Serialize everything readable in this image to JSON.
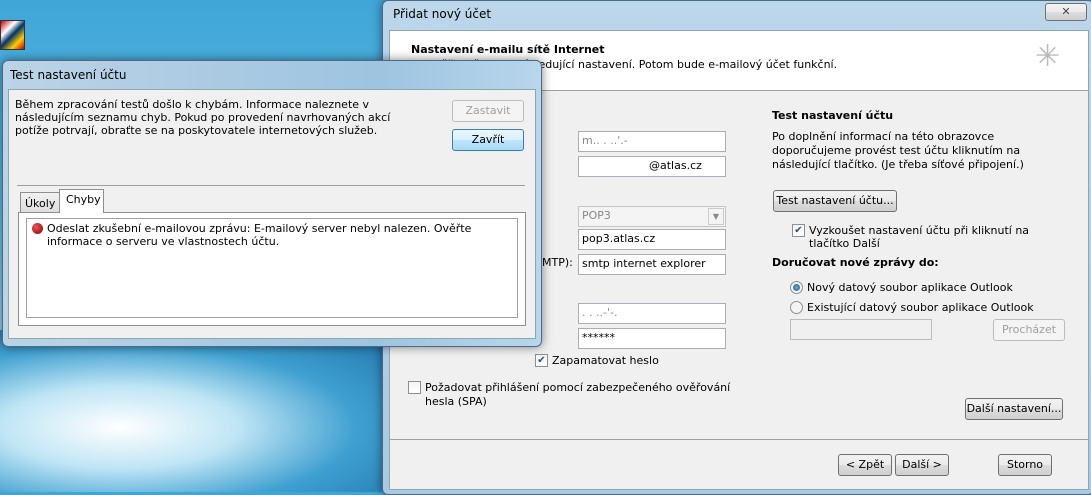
{
  "main_dialog": {
    "title": "Přidat nový účet",
    "close_symbol": "✕",
    "header_title": "Nastavení e-mailu sítě Internet",
    "header_subtitle": "Ověřte všechny následující nastavení. Potom bude e-mailový účet funkční.",
    "smtp_label_fragment": "MTP):",
    "fields": {
      "name": "m..  . ..'.-",
      "email": "@atlas.cz",
      "account_type": "POP3",
      "incoming_server": "pop3.atlas.cz",
      "outgoing_server": "smtp internet explorer",
      "username": ". .  ..-'-.",
      "password": "******"
    },
    "remember_password": "Zapamatovat heslo",
    "spa_label": "Požadovat přihlášení pomocí zabezpečeného ověřování hesla (SPA)",
    "test_section": {
      "title": "Test nastavení účtu",
      "description": "Po doplnění informací na této obrazovce doporučujeme provést test účtu kliknutím na následující tlačítko. (Je třeba síťové připojení.)",
      "test_button": "Test nastavení účtu...",
      "auto_test_label": "Vyzkoušet nastavení účtu při kliknutí na tlačítko Další"
    },
    "delivery": {
      "title": "Doručovat nové zprávy do:",
      "option_new": "Nový datový soubor aplikace Outlook",
      "option_existing": "Existující datový soubor aplikace Outlook",
      "browse_button": "Procházet"
    },
    "more_settings_button": "Další nastavení...",
    "back_button": "< Zpět",
    "next_button": "Další >",
    "cancel_button": "Storno"
  },
  "test_dialog": {
    "title": "Test nastavení účtu",
    "message": "Během zpracování testů došlo k chybám. Informace naleznete v následujícím seznamu chyb. Pokud po provedení navrhovaných akcí potíže potrvají, obraťte se na poskytovatele internetových služeb.",
    "stop_button": "Zastavit",
    "close_button": "Zavřít",
    "tabs": [
      "Úkoly",
      "Chyby"
    ],
    "errors": [
      "Odeslat zkušební e-mailovou zprávu: E-mailový server nebyl nalezen. Ověřte informace o serveru ve vlastnostech účtu."
    ]
  }
}
